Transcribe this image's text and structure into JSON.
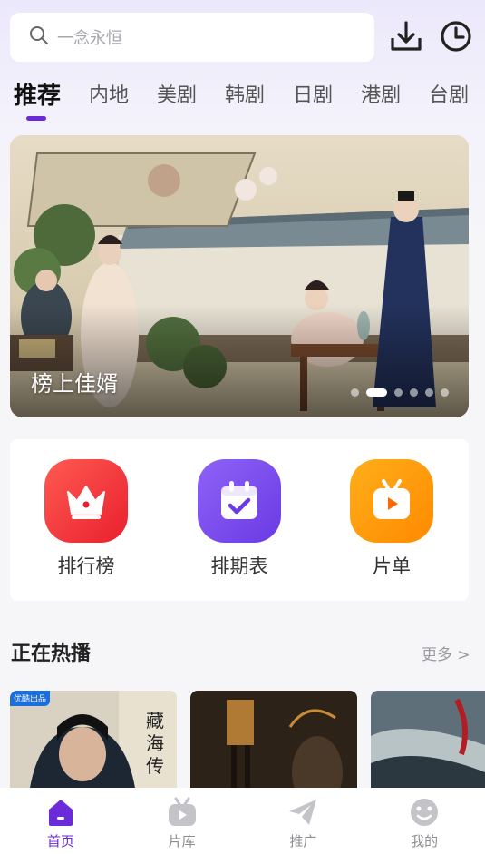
{
  "search": {
    "placeholder": "一念永恒",
    "icon": "search-icon"
  },
  "header_icons": [
    "download-icon",
    "history-clock-icon"
  ],
  "tabs": [
    {
      "label": "推荐",
      "active": true
    },
    {
      "label": "内地",
      "active": false
    },
    {
      "label": "美剧",
      "active": false
    },
    {
      "label": "韩剧",
      "active": false
    },
    {
      "label": "日剧",
      "active": false
    },
    {
      "label": "港剧",
      "active": false
    },
    {
      "label": "台剧",
      "active": false
    }
  ],
  "banner": {
    "title": "榜上佳婿",
    "slide_index": 2,
    "slide_count": 6
  },
  "shortcuts": [
    {
      "label": "排行榜",
      "icon": "crown-icon",
      "color": "#f2383f"
    },
    {
      "label": "排期表",
      "icon": "calendar-check-icon",
      "color": "#7b4cf0"
    },
    {
      "label": "片单",
      "icon": "tv-play-icon",
      "color": "#ff9a0a"
    }
  ],
  "section": {
    "title": "正在热播",
    "more": "更多 >"
  },
  "posters": [
    {
      "badge": "优酷出品"
    },
    {
      "badge": ""
    },
    {
      "badge": ""
    }
  ],
  "bottom_nav": [
    {
      "label": "首页",
      "icon": "home-icon",
      "active": true
    },
    {
      "label": "片库",
      "icon": "tv-library-icon",
      "active": false
    },
    {
      "label": "推广",
      "icon": "paper-plane-icon",
      "active": false
    },
    {
      "label": "我的",
      "icon": "profile-face-icon",
      "active": false
    }
  ],
  "colors": {
    "accent": "#6b2bd9",
    "inactive": "#c4c4c8"
  }
}
